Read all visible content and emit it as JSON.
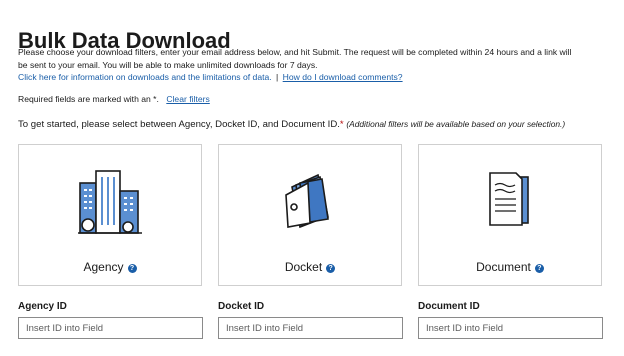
{
  "page_title": "Bulk Data Download",
  "intro": {
    "text": "Please choose your download filters, enter your email address below, and hit Submit. The request will be completed within 24 hours and a link will be sent to your email. You will be able to make unlimited downloads for 7 days.",
    "info_link": "Click here for information on downloads and the limitations of data.",
    "separator": "|",
    "comments_link": "How do I download comments?"
  },
  "required": {
    "text": "Required fields are marked with an *.",
    "clear_link": "Clear filters"
  },
  "prompt": {
    "text": "To get started, please select between Agency, Docket ID, and Document ID.",
    "star": "*",
    "note": "(Additional filters will be available based on your selection.)"
  },
  "cards": [
    {
      "label": "Agency",
      "icon": "buildings-icon",
      "help": "?"
    },
    {
      "label": "Docket",
      "icon": "folder-papers-icon",
      "help": "?"
    },
    {
      "label": "Document",
      "icon": "document-icon",
      "help": "?"
    }
  ],
  "fields": [
    {
      "label": "Agency ID",
      "placeholder": "Insert ID into Field"
    },
    {
      "label": "Docket ID",
      "placeholder": "Insert ID into Field"
    },
    {
      "label": "Document ID",
      "placeholder": "Insert ID into Field"
    }
  ],
  "colors": {
    "link": "#1a5ea8",
    "illustration_blue": "#5b8fd1",
    "required_star": "#b50909",
    "border": "#cfcfcf"
  }
}
